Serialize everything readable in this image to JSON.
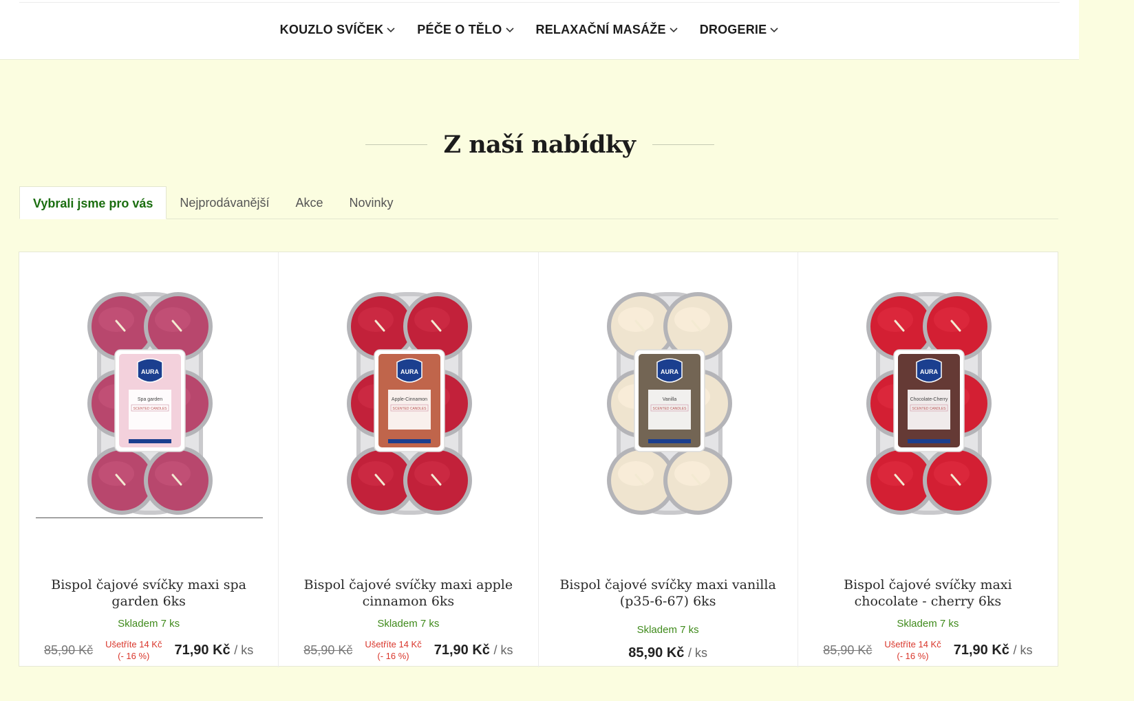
{
  "nav": {
    "items": [
      "KOUZLO SVÍČEK",
      "PÉČE O TĚLO",
      "RELAXAČNÍ MASÁŽE",
      "DROGERIE"
    ]
  },
  "section": {
    "title": "Z naší nabídky"
  },
  "tabs": [
    "Vybrali jsme pro vás",
    "Nejprodávanější",
    "Akce",
    "Novinky"
  ],
  "active_tab": "Vybrali jsme pro vás",
  "products": [
    {
      "name": "Bispol čajové svíčky maxi spa garden 6ks",
      "stock": "Skladem 7 ks",
      "old_price": "85,90 Kč",
      "save_line1": "Ušetříte 14 Kč",
      "save_line2": "(- 16 %)",
      "price": "71,90 Kč",
      "unit": "/ ks",
      "label": "Spa garden",
      "wax_color": "#b8476d",
      "label_photo": "#f1c9d6"
    },
    {
      "name": "Bispol čajové svíčky maxi apple cinnamon 6ks",
      "stock": "Skladem 7 ks",
      "old_price": "85,90 Kč",
      "save_line1": "Ušetříte 14 Kč",
      "save_line2": "(- 16 %)",
      "price": "71,90 Kč",
      "unit": "/ ks",
      "label": "Apple-Cinnamon",
      "wax_color": "#c2213a",
      "label_photo": "#b54a2b"
    },
    {
      "name": "Bispol čajové svíčky maxi vanilla (p35-6-67) 6ks",
      "stock": "Skladem 7 ks",
      "price": "85,90 Kč",
      "unit": "/ ks",
      "label": "Vanilla",
      "wax_color": "#efe4cf",
      "label_photo": "#5b4a36"
    },
    {
      "name": "Bispol čajové svíčky maxi chocolate - cherry 6ks",
      "stock": "Skladem 7 ks",
      "old_price": "85,90 Kč",
      "save_line1": "Ušetříte 14 Kč",
      "save_line2": "(- 16 %)",
      "price": "71,90 Kč",
      "unit": "/ ks",
      "label": "Chocolate-Cherry",
      "wax_color": "#d31f33",
      "label_photo": "#4a1812"
    }
  ],
  "brand": {
    "logo_text": "AURA",
    "sub_text": "SCENTED CANDLES"
  }
}
